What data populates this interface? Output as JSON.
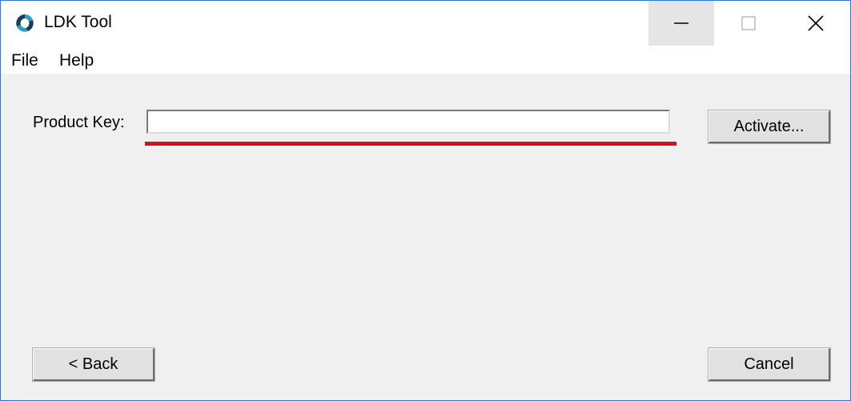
{
  "window": {
    "title": "LDK Tool",
    "controls": {
      "minimize_icon": "minimize-icon",
      "maximize_icon": "maximize-icon",
      "close_icon": "close-icon"
    }
  },
  "menubar": {
    "items": [
      {
        "label": "File"
      },
      {
        "label": "Help"
      }
    ]
  },
  "form": {
    "product_key_label": "Product Key:",
    "product_key_value": "",
    "activate_label": "Activate..."
  },
  "footer": {
    "back_label": "< Back",
    "cancel_label": "Cancel"
  },
  "colors": {
    "accent_border": "#2b78d2",
    "highlight_underline": "#d0121b",
    "window_bg": "#f0f0f0"
  }
}
